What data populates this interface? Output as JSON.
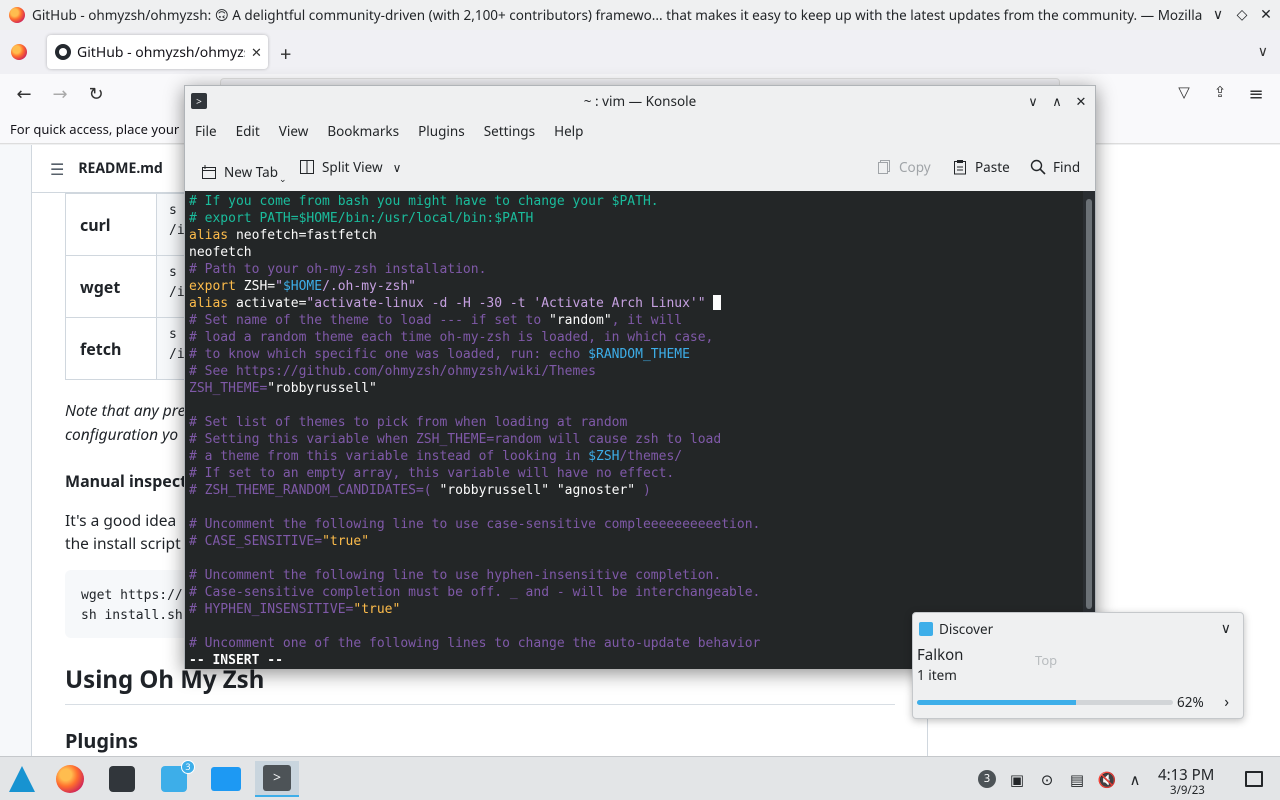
{
  "firefox": {
    "window_title": "GitHub - ohmyzsh/ohmyzsh: 🙃 A delightful community-driven (with 2,100+ contributors) framewo... that makes it easy to keep up with the latest updates from the community. — Mozilla Firefox",
    "window_controls": {
      "minimize": "∨",
      "maximize": "◇",
      "close": "✕"
    },
    "tab_title": "GitHub - ohmyzsh/ohmyzsh",
    "tab_close": "✕",
    "new_tab": "+",
    "tabs_menu": "∨",
    "nav": {
      "back": "←",
      "forward": "→",
      "reload": "↻",
      "pocket": "▽",
      "extensions": "⇪",
      "menu": "≡"
    },
    "bookmarks_hint": "For quick access, place your"
  },
  "readme": {
    "filename": "README.md",
    "methods": [
      {
        "name": "curl",
        "cmd": "s\n/i"
      },
      {
        "name": "wget",
        "cmd": "s\n/i"
      },
      {
        "name": "fetch",
        "cmd": "s\n/i"
      }
    ],
    "note_line1": "Note that any pre",
    "note_line2": "configuration yo",
    "manual_heading": "Manual inspect",
    "text_line1": "It's a good idea",
    "text_line2": "the install script",
    "code_line1": "wget https://",
    "code_line2": "sh install.sh",
    "h2": "Using Oh My Zsh",
    "h3": "Plugins"
  },
  "konsole": {
    "title": "~ : vim — Konsole",
    "controls": {
      "minimize": "∨",
      "maximize": "∧",
      "close": "✕"
    },
    "menu": [
      "File",
      "Edit",
      "View",
      "Bookmarks",
      "Plugins",
      "Settings",
      "Help"
    ],
    "toolbar": {
      "new_tab": "New Tab",
      "split_view": "Split View",
      "copy": "Copy",
      "paste": "Paste",
      "find": "Find"
    },
    "terminal_lines": [
      "# If you come from bash you might have to change your $PATH.",
      "# export PATH=$HOME/bin:/usr/local/bin:$PATH",
      "alias neofetch=fastfetch",
      "neofetch",
      "# Path to your oh-my-zsh installation.",
      "export ZSH=\"$HOME/.oh-my-zsh\"",
      "alias activate=\"activate-linux -d -H -30 -t 'Activate Arch Linux'\"",
      "# Set name of the theme to load --- if set to \"random\", it will",
      "# load a random theme each time oh-my-zsh is loaded, in which case,",
      "# to know which specific one was loaded, run: echo $RANDOM_THEME",
      "# See https://github.com/ohmyzsh/ohmyzsh/wiki/Themes",
      "ZSH_THEME=\"robbyrussell\"",
      "",
      "# Set list of themes to pick from when loading at random",
      "# Setting this variable when ZSH_THEME=random will cause zsh to load",
      "# a theme from this variable instead of looking in $ZSH/themes/",
      "# If set to an empty array, this variable will have no effect.",
      "# ZSH_THEME_RANDOM_CANDIDATES=( \"robbyrussell\" \"agnoster\" )",
      "",
      "# Uncomment the following line to use case-sensitive compleeeeeeeeeetion.",
      "# CASE_SENSITIVE=\"true\"",
      "",
      "# Uncomment the following line to use hyphen-insensitive completion.",
      "# Case-sensitive completion must be off. _ and - will be interchangeable.",
      "# HYPHEN_INSENSITIVE=\"true\"",
      "",
      "# Uncomment one of the following lines to change the auto-update behavior"
    ],
    "mode_line": "-- INSERT --"
  },
  "notification": {
    "app_name": "Discover",
    "title": "Falkon",
    "subtitle": "1 item",
    "progress": 0.62,
    "progress_label": "62%",
    "ghost_text": "Top"
  },
  "taskbar": {
    "discover_badge": "3",
    "tray_badge": "3",
    "time": "4:13 PM",
    "date": "3/9/23"
  },
  "colors": {
    "comment": "#7f59a8",
    "keyword": "#fdbc4b",
    "variable": "#3daee9",
    "terminal_bg": "#232627",
    "accent": "#3daee9"
  }
}
